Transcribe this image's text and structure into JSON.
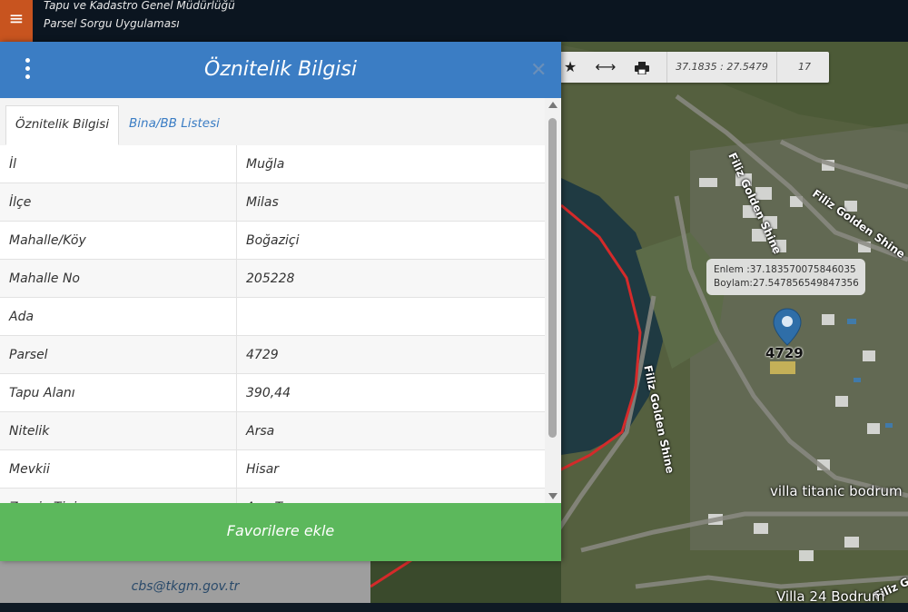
{
  "app": {
    "title_line1": "Tapu ve Kadastro Genel Müdürlüğü",
    "title_line2": "Parsel Sorgu Uygulaması",
    "menu_icon": "hamburger-icon"
  },
  "panel": {
    "title": "Öznitelik Bilgisi",
    "tabs": [
      {
        "label": "Öznitelik Bilgisi",
        "active": true
      },
      {
        "label": "Bina/BB Listesi",
        "active": false
      }
    ],
    "rows": [
      {
        "key": "İl",
        "value": "Muğla"
      },
      {
        "key": "İlçe",
        "value": "Milas"
      },
      {
        "key": "Mahalle/Köy",
        "value": "Boğaziçi"
      },
      {
        "key": "Mahalle No",
        "value": "205228"
      },
      {
        "key": "Ada",
        "value": ""
      },
      {
        "key": "Parsel",
        "value": "4729"
      },
      {
        "key": "Tapu Alanı",
        "value": "390,44"
      },
      {
        "key": "Nitelik",
        "value": "Arsa"
      },
      {
        "key": "Mevkii",
        "value": "Hisar"
      },
      {
        "key": "Zemin Tipi",
        "value": "Ana Taşınmaz"
      }
    ],
    "favorite_button": "Favorilere ekle"
  },
  "footer": {
    "email": "cbs@tkgm.gov.tr"
  },
  "map": {
    "coords": "37.1835 : 27.5479",
    "zoom": "17",
    "tooltip_lat": "Enlem :37.183570075846035",
    "tooltip_lon": "Boylam:27.547856549847356",
    "parcel_label": "4729",
    "labels": {
      "villa1": "villa titanic bodrum",
      "villa2": "Villa 24 Bodrum",
      "road1": "Filiz Golden Shine",
      "road2": "Filiz Golden Shine",
      "road3": "Filiz Golden Shine",
      "road4": "Filiz G"
    }
  },
  "colors": {
    "header_blue": "#3b7dc4",
    "favorite_green": "#5cb85c",
    "menu_orange": "#c8541f",
    "boundary_red": "#d42a2a"
  }
}
